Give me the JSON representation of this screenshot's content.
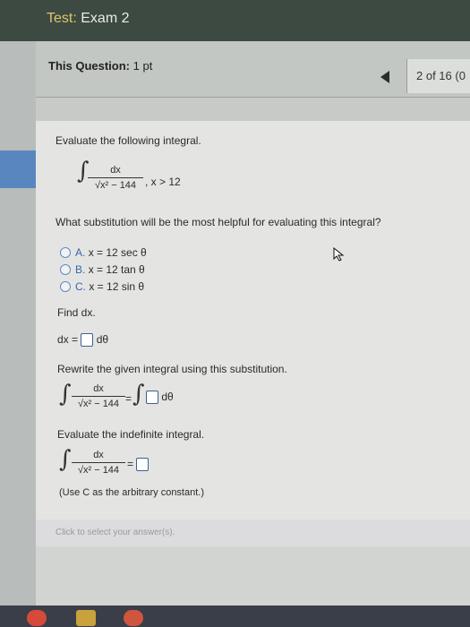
{
  "header": {
    "label": "Test:",
    "name": "Exam 2"
  },
  "question_bar": {
    "label": "This Question:",
    "points": "1 pt",
    "pager": "2 of 16 (0"
  },
  "question": {
    "instruction": "Evaluate the following integral.",
    "integral_num": "dx",
    "integral_den": "√x² − 144",
    "condition": ", x > 12",
    "sub_prompt": "What substitution will be the most helpful for evaluating this integral?",
    "options": [
      {
        "letter": "A.",
        "text": "x = 12 sec θ"
      },
      {
        "letter": "B.",
        "text": "x = 12 tan θ"
      },
      {
        "letter": "C.",
        "text": "x = 12 sin θ"
      }
    ],
    "find_dx": "Find dx.",
    "dx_lhs": "dx =",
    "dx_rhs": "dθ",
    "rewrite": "Rewrite the given integral using this substitution.",
    "rewrite_eq": "=",
    "rewrite_dtheta": "dθ",
    "evaluate": "Evaluate the indefinite integral.",
    "eval_eq": "=",
    "note": "(Use C as the arbitrary constant.)"
  },
  "answer_hint": "Click to select your answer(s).",
  "colors": {
    "header_bg": "#3c4a41",
    "title_label": "#e2c46a",
    "accent": "#3a66a8"
  }
}
